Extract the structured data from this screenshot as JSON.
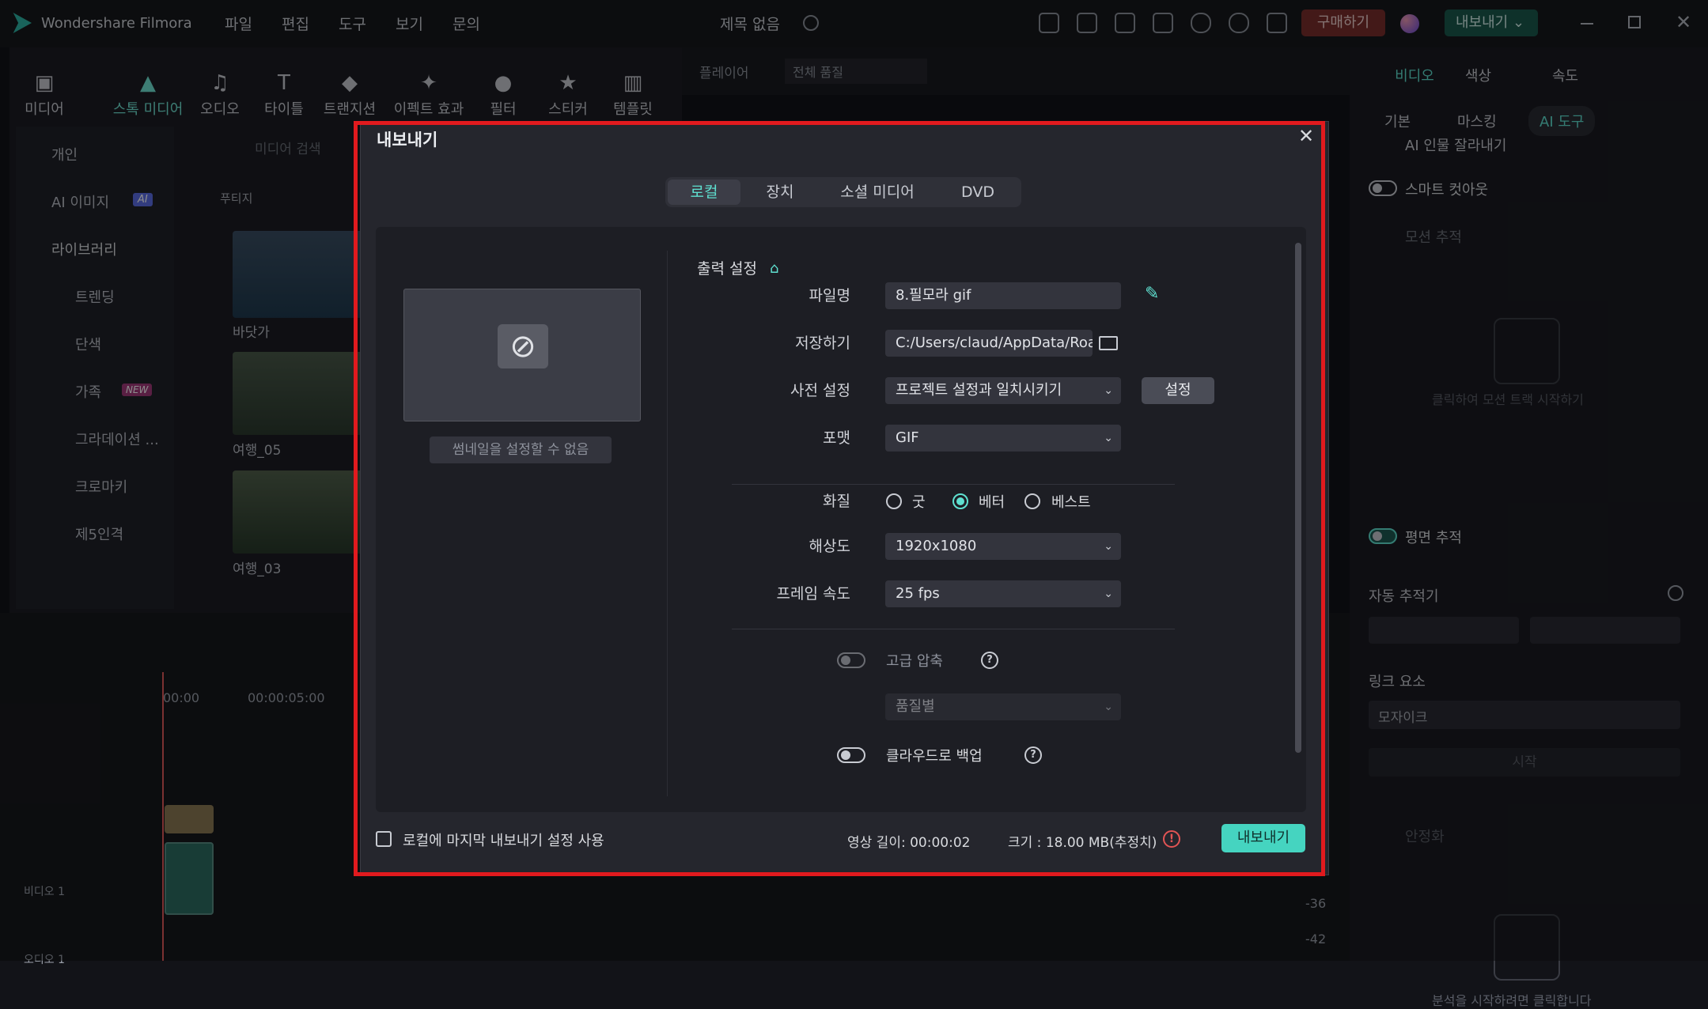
{
  "app": {
    "name": "Wondershare Filmora",
    "project_title": "제목 없음",
    "buy_label": "구매하기",
    "export_label": "내보내기"
  },
  "menu": [
    "파일",
    "편집",
    "도구",
    "보기",
    "문의"
  ],
  "toolbar": [
    {
      "label": "미디어",
      "icon": "media-icon"
    },
    {
      "label": "스톡 미디어",
      "icon": "stock-media-icon"
    },
    {
      "label": "오디오",
      "icon": "audio-icon"
    },
    {
      "label": "타이틀",
      "icon": "title-icon"
    },
    {
      "label": "트랜지션",
      "icon": "transition-icon"
    },
    {
      "label": "이펙트 효과",
      "icon": "effects-icon"
    },
    {
      "label": "필터",
      "icon": "filter-icon"
    },
    {
      "label": "스티커",
      "icon": "sticker-icon"
    },
    {
      "label": "템플릿",
      "icon": "template-icon"
    }
  ],
  "library": {
    "personal": "개인",
    "ai_image": "AI 이미지",
    "ai_badge": "AI",
    "library": "라이브러리",
    "items": [
      "트렌딩",
      "단색",
      "가족",
      "그라데이션 ...",
      "크로마키",
      "제5인격"
    ],
    "new_badge": "NEW",
    "search_placeholder": "미디어 검색",
    "section": "푸티지",
    "thumbs": [
      "바닷가",
      "여행_05",
      "여행_03"
    ]
  },
  "player": {
    "label": "플레이어",
    "quality": "전체 품질"
  },
  "timeline": {
    "t0": "00:00",
    "t1": "00:00:05:00",
    "video_track": "비디오 1",
    "audio_track": "오디오 1",
    "meter_36": "-36",
    "meter_42": "-42"
  },
  "right_panel": {
    "tabs": [
      "비디오",
      "색상",
      "속도"
    ],
    "subtabs": [
      "기본",
      "마스킹",
      "AI 도구"
    ],
    "ai_cutout": "AI 인물 잘라내기",
    "smart_cutout": "스마트 컷아웃",
    "motion_tracking": "모션 추적",
    "motion_hint": "클릭하여 모션 트랙 시작하기",
    "planar_tracking": "평면 추적",
    "auto_tracker": "자동 추적기",
    "link_element": "링크 요소",
    "link_value": "모자이크",
    "start": "시작",
    "stabilize": "안정화",
    "bottom_hint": "분석을 시작하려면 클릭합니다"
  },
  "dialog": {
    "title": "내보내기",
    "tabs": [
      "로컬",
      "장치",
      "소셜 미디어",
      "DVD"
    ],
    "thumbnail_note": "썸네일을 설정할 수 없음",
    "output_settings": "출력 설정",
    "filename_label": "파일명",
    "filename": "8.필모라 gif",
    "save_label": "저장하기",
    "save_path": "C:/Users/claud/AppData/Roar",
    "preset_label": "사전 설정",
    "preset": "프로젝트 설정과 일치시키기",
    "preset_btn": "설정",
    "format_label": "포맷",
    "format": "GIF",
    "quality_label": "화질",
    "quality_options": [
      "굿",
      "베터",
      "베스트"
    ],
    "quality_selected": "베터",
    "resolution_label": "해상도",
    "resolution": "1920x1080",
    "framerate_label": "프레임 속도",
    "framerate": "25 fps",
    "advanced_label": "고급 압축",
    "advanced_select": "품질별",
    "cloud_label": "클라우드로 백업",
    "use_last": "로컬에 마지막 내보내기 설정 사용",
    "duration": "영상 길이: 00:00:02",
    "size": "크기 : 18.00 MB(추정치)",
    "export_btn": "내보내기"
  },
  "colors": {
    "accent": "#5fe0d0",
    "highlight": "#e11a1e",
    "buy": "#a9403b",
    "export": "#1f8a74"
  }
}
